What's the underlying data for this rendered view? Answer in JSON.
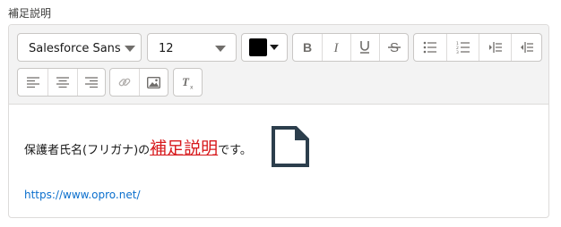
{
  "field": {
    "label": "補足説明"
  },
  "toolbar": {
    "font_family": "Salesforce Sans",
    "font_size": "12",
    "text_color": "#000000",
    "buttons": {
      "bold": "bold-icon",
      "italic": "italic-icon",
      "underline": "underline-icon",
      "strikethrough": "strikethrough-icon",
      "bullet_list": "bullet-list-icon",
      "numbered_list": "numbered-list-icon",
      "indent": "indent-icon",
      "outdent": "outdent-icon",
      "align_left": "align-left-icon",
      "align_center": "align-center-icon",
      "align_right": "align-right-icon",
      "link": "link-icon",
      "image": "image-icon",
      "clear_formatting": "clear-formatting-icon"
    }
  },
  "content": {
    "text_before": "保護者氏名(フリガナ)の",
    "highlighted_text": "補足説明",
    "highlighted_color": "#d7191c",
    "text_after": "です。",
    "document_icon": "document-icon",
    "link": "https://www.opro.net/"
  }
}
